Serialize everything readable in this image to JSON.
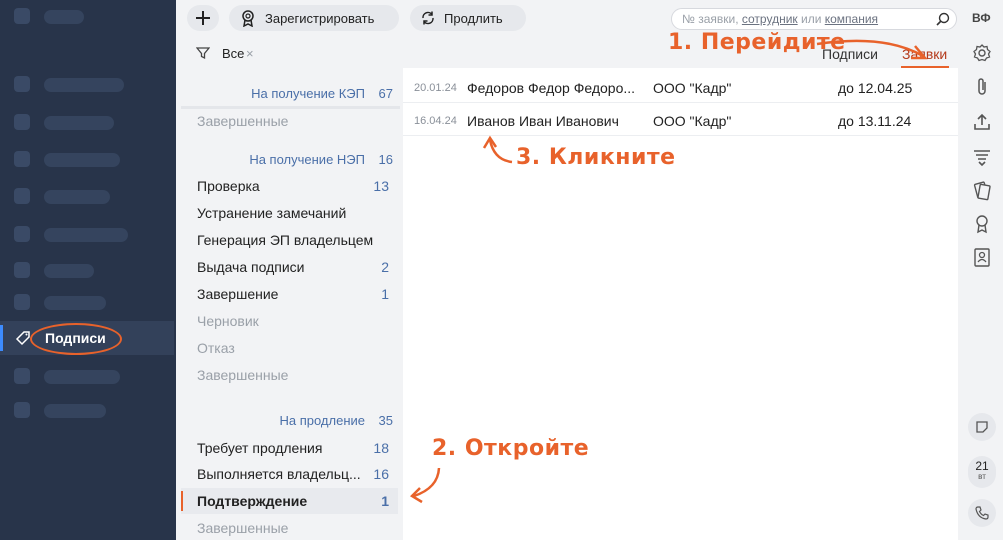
{
  "sidebar": {
    "active_item": {
      "label": "Подписи",
      "icon": "tag-icon"
    }
  },
  "toolbar": {
    "add_icon": "plus-icon",
    "register_label": "Зарегистрировать",
    "register_icon": "certificate-icon",
    "renew_label": "Продлить",
    "renew_icon": "refresh-icon"
  },
  "search": {
    "placeholder_part1": "№ заявки, ",
    "placeholder_link1": "сотрудник",
    "placeholder_part2": " или ",
    "placeholder_link2": "компания"
  },
  "user": {
    "initials": "ВФ"
  },
  "filter": {
    "label": "Все",
    "clear": "×"
  },
  "tabs": [
    {
      "label": "Подписи",
      "active": false
    },
    {
      "label": "Заявки",
      "active": true
    }
  ],
  "categories": [
    {
      "title": "На получение КЭП",
      "count": "67",
      "items": [
        {
          "label": "Завершенные",
          "count": "",
          "dim": true
        }
      ]
    },
    {
      "title": "На получение НЭП",
      "count": "16",
      "items": [
        {
          "label": "Проверка",
          "count": "13",
          "dim": false
        },
        {
          "label": "Устранение замечаний",
          "count": "",
          "dim": false
        },
        {
          "label": "Генерация ЭП владельцем",
          "count": "",
          "dim": false
        },
        {
          "label": "Выдача подписи",
          "count": "2",
          "dim": false
        },
        {
          "label": "Завершение",
          "count": "1",
          "dim": false
        },
        {
          "label": "Черновик",
          "count": "",
          "dim": true
        },
        {
          "label": "Отказ",
          "count": "",
          "dim": true
        },
        {
          "label": "Завершенные",
          "count": "",
          "dim": true
        }
      ]
    },
    {
      "title": "На продление",
      "count": "35",
      "items": [
        {
          "label": "Требует продления",
          "count": "18",
          "dim": false
        },
        {
          "label": "Выполняется владельц...",
          "count": "16",
          "dim": false
        },
        {
          "label": "Подтверждение",
          "count": "1",
          "dim": false,
          "selected": true
        },
        {
          "label": "Завершенные",
          "count": "",
          "dim": true
        }
      ]
    }
  ],
  "requests": [
    {
      "date": "20.01.24",
      "name": "Федоров Федор Федоро...",
      "org": "ООО \"Кадр\"",
      "until": "до 12.04.25"
    },
    {
      "date": "16.04.24",
      "name": "Иванов Иван Иванович",
      "org": "ООО \"Кадр\"",
      "until": "до 13.11.24"
    }
  ],
  "annotations": {
    "step1": "1. Перейдите",
    "step2": "2. Откройте",
    "step3": "3. Кликните"
  },
  "rail": {
    "icons": [
      "gear-icon",
      "paperclip-icon",
      "upload-icon",
      "filter-list-icon",
      "cards-icon",
      "certificate-icon",
      "document-user-icon",
      "note-icon",
      "phone-icon"
    ],
    "calendar_day": "21",
    "calendar_weekday": "вт"
  },
  "colors": {
    "accent": "#e8622b",
    "nav_bg": "#28344a",
    "link": "#4a6fa8"
  }
}
